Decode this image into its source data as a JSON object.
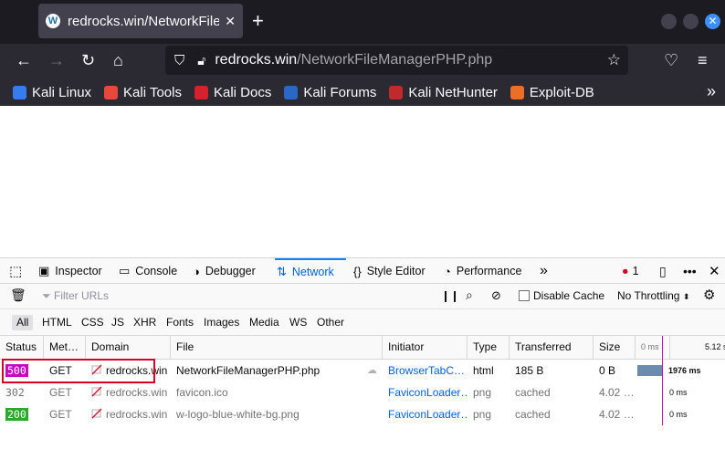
{
  "browser": {
    "tab_title": "redrocks.win/NetworkFileManagerPHP.php",
    "tab_title_visible": "redrocks.win/NetworkFile",
    "url_domain": "redrocks.win",
    "url_path": "/NetworkFileManagerPHP.php",
    "bookmarks": [
      {
        "label": "Kali Linux",
        "icon": "kali-dragon-icon",
        "color": "#367bf0"
      },
      {
        "label": "Kali Tools",
        "icon": "kali-tools-icon",
        "color": "#e8473b"
      },
      {
        "label": "Kali Docs",
        "icon": "kali-docs-icon",
        "color": "#d4212c"
      },
      {
        "label": "Kali Forums",
        "icon": "kali-forums-icon",
        "color": "#2b67c6"
      },
      {
        "label": "Kali NetHunter",
        "icon": "kali-nethunter-icon",
        "color": "#c02a2a"
      },
      {
        "label": "Exploit-DB",
        "icon": "exploit-db-icon",
        "color": "#ec6f28"
      }
    ]
  },
  "devtools": {
    "tabs": [
      {
        "label": "Inspector",
        "icon": "inspector-icon"
      },
      {
        "label": "Console",
        "icon": "console-icon"
      },
      {
        "label": "Debugger",
        "icon": "debugger-icon"
      },
      {
        "label": "Network",
        "icon": "network-icon",
        "active": true
      },
      {
        "label": "Style Editor",
        "icon": "style-editor-icon"
      },
      {
        "label": "Performance",
        "icon": "performance-icon"
      }
    ],
    "error_count": "1",
    "filter_placeholder": "Filter URLs",
    "disable_cache_label": "Disable Cache",
    "throttling_label": "No Throttling",
    "type_filters": [
      "All",
      "HTML",
      "CSS",
      "JS",
      "XHR",
      "Fonts",
      "Images",
      "Media",
      "WS",
      "Other"
    ],
    "columns": {
      "status": "Status",
      "method": "Met…",
      "domain": "Domain",
      "file": "File",
      "initiator": "Initiator",
      "type": "Type",
      "transferred": "Transferred",
      "size": "Size",
      "wf_0": "0 ms",
      "wf_end": "5.12 s"
    },
    "requests": [
      {
        "status": "500",
        "status_color": "#c50bbf",
        "method": "GET",
        "domain": "redrocks.win",
        "file": "NetworkFileManagerPHP.php",
        "initiator": "BrowserTabC…",
        "type": "html",
        "transferred": "185 B",
        "size": "0 B",
        "timing": "1976 ms"
      },
      {
        "status": "302",
        "status_color": "",
        "method": "GET",
        "domain": "redrocks.win",
        "file": "favicon.ico",
        "initiator": "FaviconLoader…",
        "type": "png",
        "transferred": "cached",
        "size": "4.02 …",
        "timing": "0 ms"
      },
      {
        "status": "200",
        "status_color": "#2ca92c",
        "method": "GET",
        "domain": "redrocks.win",
        "file": "w-logo-blue-white-bg.png",
        "initiator": "FaviconLoader…",
        "type": "png",
        "transferred": "cached",
        "size": "4.02 …",
        "timing": "0 ms"
      }
    ]
  }
}
